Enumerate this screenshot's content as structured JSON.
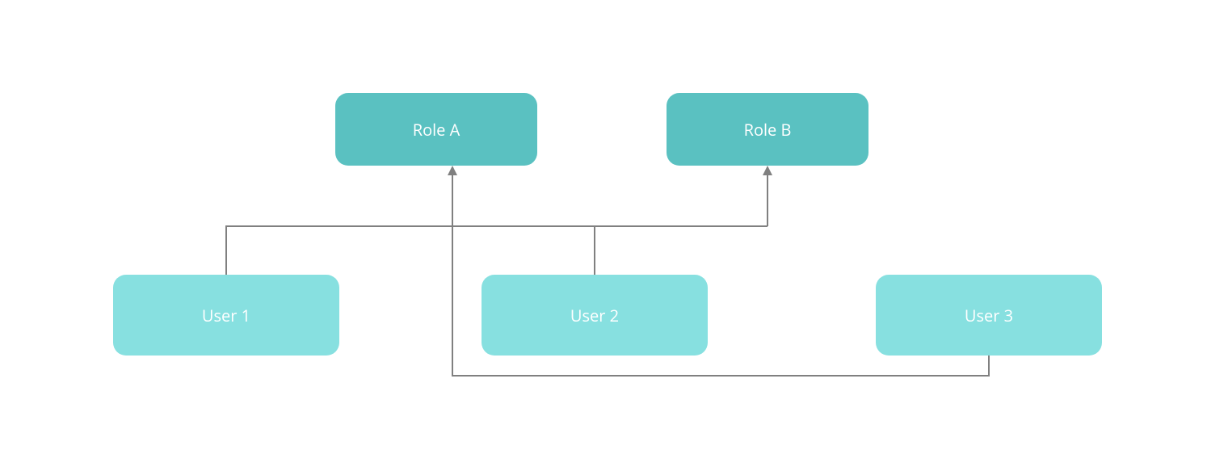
{
  "diagram": {
    "roles": {
      "a": {
        "label": "Role A"
      },
      "b": {
        "label": "Role B"
      }
    },
    "users": {
      "u1": {
        "label": "User 1"
      },
      "u2": {
        "label": "User 2"
      },
      "u3": {
        "label": "User 3"
      }
    },
    "connections": [
      {
        "from": "u1",
        "to": "a"
      },
      {
        "from": "u2",
        "to": "a"
      },
      {
        "from": "u2",
        "to": "b"
      },
      {
        "from": "u3",
        "to": "a"
      }
    ]
  }
}
